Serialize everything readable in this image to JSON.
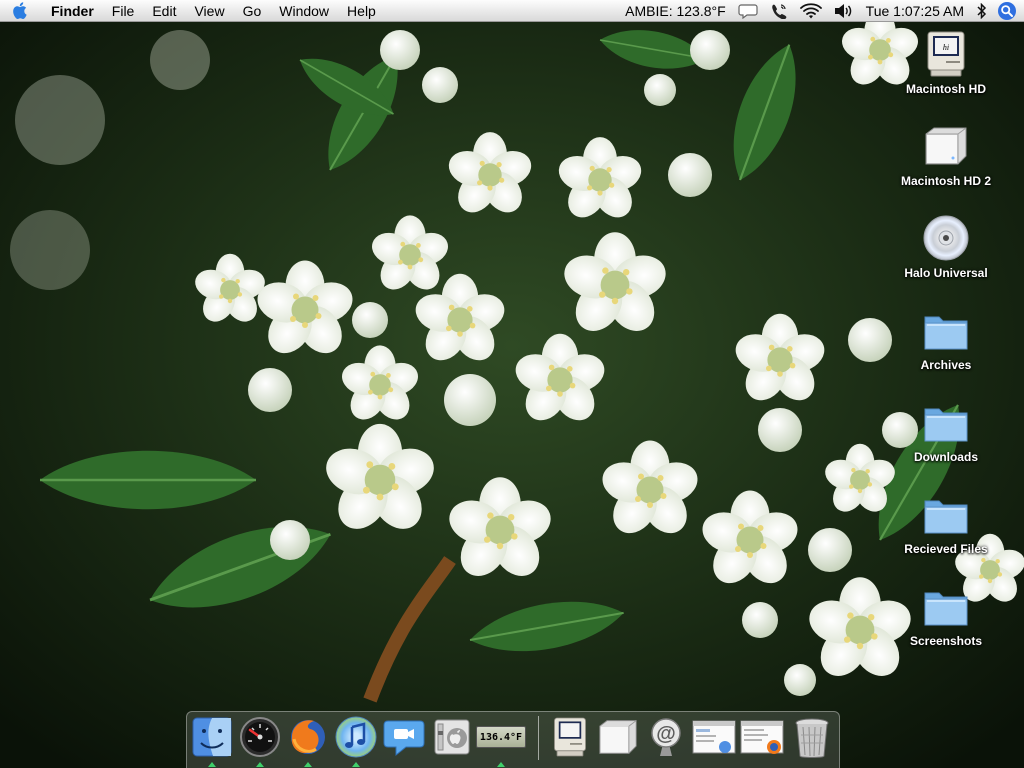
{
  "menubar": {
    "app_name": "Finder",
    "menus": [
      "File",
      "Edit",
      "View",
      "Go",
      "Window",
      "Help"
    ],
    "temperature_status": "AMBIE: 123.8°F",
    "clock": "Tue 1:07:25 AM"
  },
  "desktop_icons": [
    {
      "label": "Macintosh HD",
      "icon": "classic-mac-icon"
    },
    {
      "label": "Macintosh HD 2",
      "icon": "external-drive-icon"
    },
    {
      "label": "Halo Universal",
      "icon": "cd-disc-icon"
    },
    {
      "label": "Archives",
      "icon": "folder-icon"
    },
    {
      "label": "Downloads",
      "icon": "folder-icon"
    },
    {
      "label": "Recieved Files",
      "icon": "folder-icon"
    },
    {
      "label": "Screenshots",
      "icon": "folder-icon"
    }
  ],
  "dock": {
    "temperature_widget": "136.4°F",
    "items": [
      "finder",
      "dashboard",
      "firefox",
      "itunes",
      "ichat",
      "system-preferences",
      "temperature-monitor",
      "macintosh-hd",
      "external-drive",
      "mail",
      "document-stack",
      "downloads-stack",
      "trash"
    ]
  },
  "colors": {
    "menubar": "#e9e9e9",
    "folder_blue": "#8fc3ee",
    "running_indicator": "#3fcf6a"
  }
}
